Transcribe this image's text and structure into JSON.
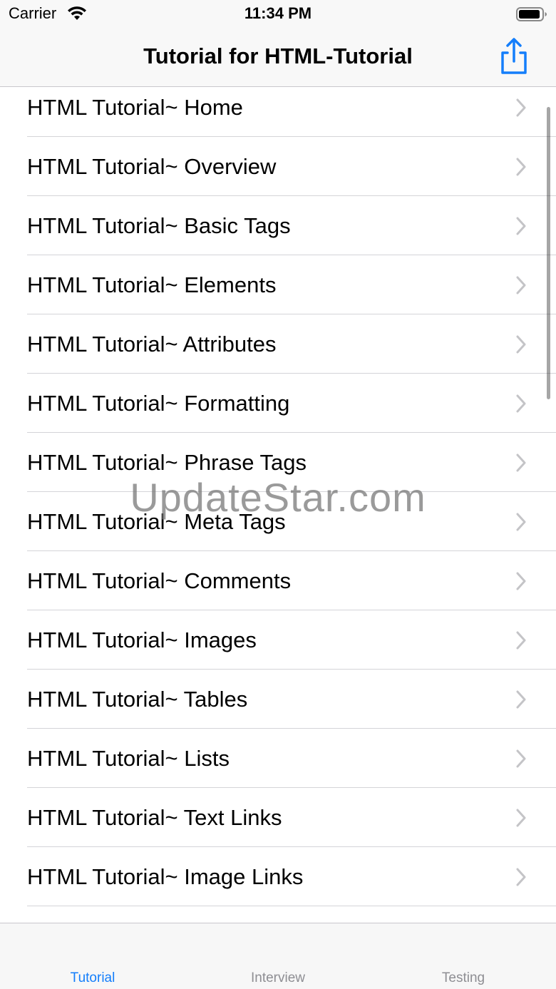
{
  "status_bar": {
    "carrier": "Carrier",
    "time": "11:34 PM"
  },
  "nav": {
    "title": "Tutorial for HTML-Tutorial",
    "share_icon": "share-icon"
  },
  "list": {
    "items": [
      {
        "label": "HTML Tutorial~ Home"
      },
      {
        "label": "HTML Tutorial~ Overview"
      },
      {
        "label": "HTML Tutorial~ Basic Tags"
      },
      {
        "label": "HTML Tutorial~ Elements"
      },
      {
        "label": "HTML Tutorial~ Attributes"
      },
      {
        "label": "HTML Tutorial~ Formatting"
      },
      {
        "label": "HTML Tutorial~ Phrase Tags"
      },
      {
        "label": "HTML Tutorial~ Meta Tags"
      },
      {
        "label": "HTML Tutorial~ Comments"
      },
      {
        "label": "HTML Tutorial~ Images"
      },
      {
        "label": "HTML Tutorial~ Tables"
      },
      {
        "label": "HTML Tutorial~ Lists"
      },
      {
        "label": "HTML Tutorial~ Text Links"
      },
      {
        "label": "HTML Tutorial~ Image Links"
      }
    ]
  },
  "watermark": "UpdateStar.com",
  "tab_bar": {
    "tabs": [
      {
        "label": "Tutorial",
        "active": true
      },
      {
        "label": "Interview",
        "active": false
      },
      {
        "label": "Testing",
        "active": false
      }
    ]
  },
  "colors": {
    "accent": "#147efb",
    "inactive_tab": "#8e8e93",
    "chevron": "#c4c4c7"
  }
}
